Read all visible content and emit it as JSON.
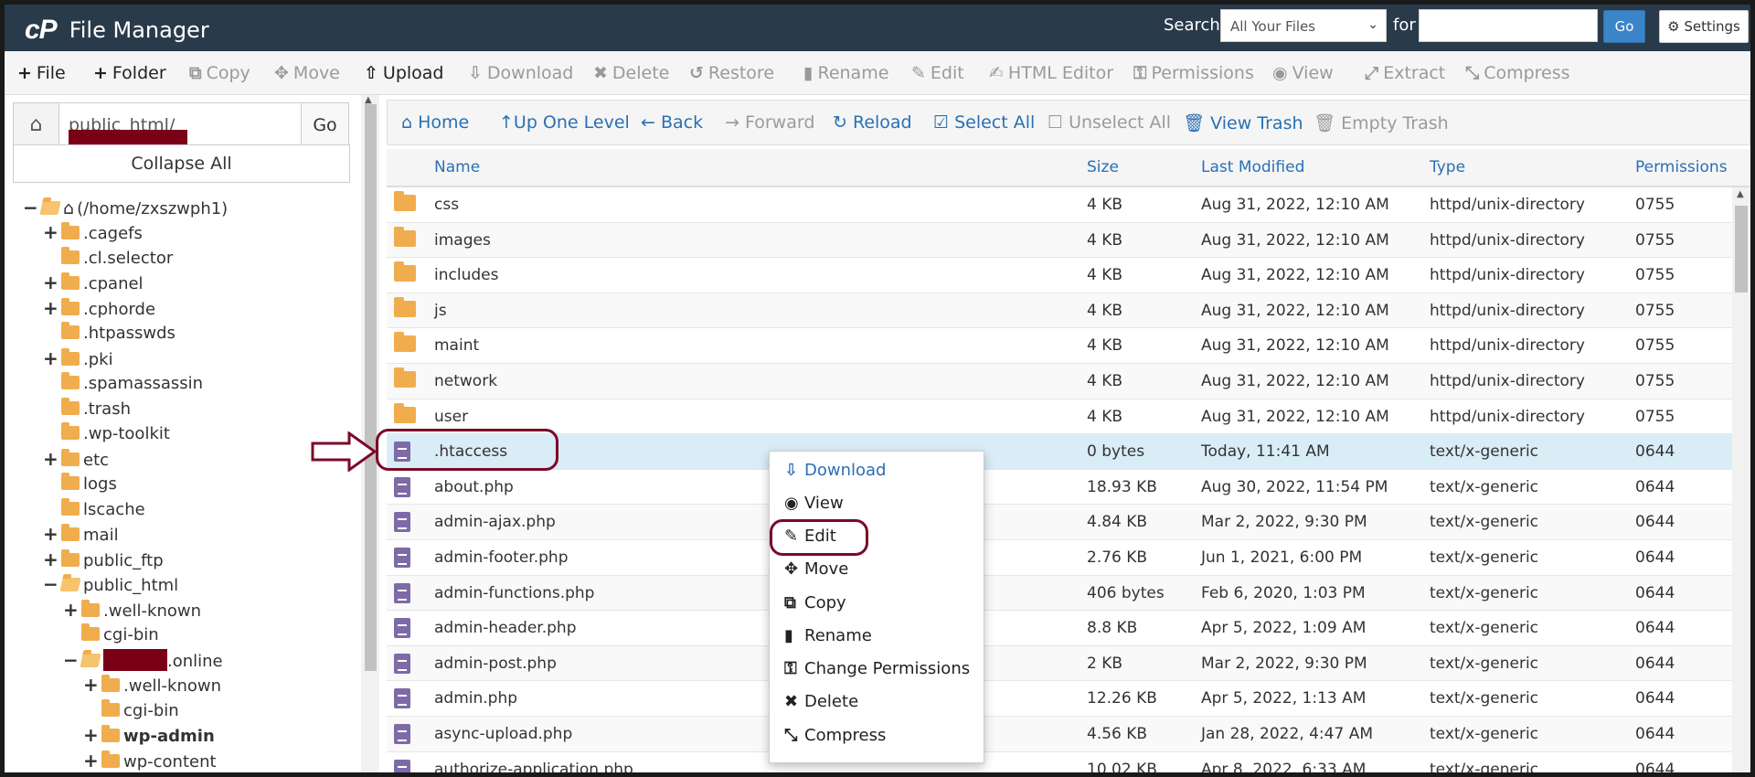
{
  "header": {
    "logo": "cP",
    "title": "File Manager",
    "search_label": "Search",
    "search_scope": "All Your Files",
    "for_label": "for",
    "search_value": "",
    "go_label": "Go",
    "settings_label": "Settings"
  },
  "toolbar": {
    "file": "File",
    "folder": "Folder",
    "copy": "Copy",
    "move": "Move",
    "upload": "Upload",
    "download": "Download",
    "delete": "Delete",
    "restore": "Restore",
    "rename": "Rename",
    "edit": "Edit",
    "html_editor": "HTML Editor",
    "permissions": "Permissions",
    "view": "View",
    "extract": "Extract",
    "compress": "Compress"
  },
  "sidebar": {
    "path_value": "public_html/",
    "go_label": "Go",
    "collapse_label": "Collapse All",
    "tree": [
      {
        "label": "(/home/zxszwph1)"
      },
      {
        "label": ".cagefs"
      },
      {
        "label": ".cl.selector"
      },
      {
        "label": ".cpanel"
      },
      {
        "label": ".cphorde"
      },
      {
        "label": ".htpasswds"
      },
      {
        "label": ".pki"
      },
      {
        "label": ".spamassassin"
      },
      {
        "label": ".trash"
      },
      {
        "label": ".wp-toolkit"
      },
      {
        "label": "etc"
      },
      {
        "label": "logs"
      },
      {
        "label": "lscache"
      },
      {
        "label": "mail"
      },
      {
        "label": "public_ftp"
      },
      {
        "label": "public_html"
      },
      {
        "label": ".well-known"
      },
      {
        "label": "cgi-bin"
      },
      {
        "label": ".online"
      },
      {
        "label": ".well-known"
      },
      {
        "label": "cgi-bin"
      },
      {
        "label": "wp-admin"
      },
      {
        "label": "wp-content"
      }
    ]
  },
  "nav": {
    "home": "Home",
    "up": "Up One Level",
    "back": "Back",
    "forward": "Forward",
    "reload": "Reload",
    "select_all": "Select All",
    "unselect_all": "Unselect All",
    "view_trash": "View Trash",
    "empty_trash": "Empty Trash"
  },
  "table": {
    "columns": [
      "Name",
      "Size",
      "Last Modified",
      "Type",
      "Permissions"
    ],
    "rows": [
      {
        "icon": "folder",
        "name": "css",
        "size": "4 KB",
        "modified": "Aug 31, 2022, 12:10 AM",
        "type": "httpd/unix-directory",
        "perm": "0755"
      },
      {
        "icon": "folder",
        "name": "images",
        "size": "4 KB",
        "modified": "Aug 31, 2022, 12:10 AM",
        "type": "httpd/unix-directory",
        "perm": "0755"
      },
      {
        "icon": "folder",
        "name": "includes",
        "size": "4 KB",
        "modified": "Aug 31, 2022, 12:10 AM",
        "type": "httpd/unix-directory",
        "perm": "0755"
      },
      {
        "icon": "folder",
        "name": "js",
        "size": "4 KB",
        "modified": "Aug 31, 2022, 12:10 AM",
        "type": "httpd/unix-directory",
        "perm": "0755"
      },
      {
        "icon": "folder",
        "name": "maint",
        "size": "4 KB",
        "modified": "Aug 31, 2022, 12:10 AM",
        "type": "httpd/unix-directory",
        "perm": "0755"
      },
      {
        "icon": "folder",
        "name": "network",
        "size": "4 KB",
        "modified": "Aug 31, 2022, 12:10 AM",
        "type": "httpd/unix-directory",
        "perm": "0755"
      },
      {
        "icon": "folder",
        "name": "user",
        "size": "4 KB",
        "modified": "Aug 31, 2022, 12:10 AM",
        "type": "httpd/unix-directory",
        "perm": "0755"
      },
      {
        "icon": "file",
        "name": ".htaccess",
        "size": "0 bytes",
        "modified": "Today, 11:41 AM",
        "type": "text/x-generic",
        "perm": "0644",
        "selected": true
      },
      {
        "icon": "file",
        "name": "about.php",
        "size": "18.93 KB",
        "modified": "Aug 30, 2022, 11:54 PM",
        "type": "text/x-generic",
        "perm": "0644"
      },
      {
        "icon": "file",
        "name": "admin-ajax.php",
        "size": "4.84 KB",
        "modified": "Mar 2, 2022, 9:30 PM",
        "type": "text/x-generic",
        "perm": "0644"
      },
      {
        "icon": "file",
        "name": "admin-footer.php",
        "size": "2.76 KB",
        "modified": "Jun 1, 2021, 6:00 PM",
        "type": "text/x-generic",
        "perm": "0644"
      },
      {
        "icon": "file",
        "name": "admin-functions.php",
        "size": "406 bytes",
        "modified": "Feb 6, 2020, 1:03 PM",
        "type": "text/x-generic",
        "perm": "0644"
      },
      {
        "icon": "file",
        "name": "admin-header.php",
        "size": "8.8 KB",
        "modified": "Apr 5, 2022, 1:09 AM",
        "type": "text/x-generic",
        "perm": "0644"
      },
      {
        "icon": "file",
        "name": "admin-post.php",
        "size": "2 KB",
        "modified": "Mar 2, 2022, 9:30 PM",
        "type": "text/x-generic",
        "perm": "0644"
      },
      {
        "icon": "file",
        "name": "admin.php",
        "size": "12.26 KB",
        "modified": "Apr 5, 2022, 1:13 AM",
        "type": "text/x-generic",
        "perm": "0644"
      },
      {
        "icon": "file",
        "name": "async-upload.php",
        "size": "4.56 KB",
        "modified": "Jan 28, 2022, 4:47 AM",
        "type": "text/x-generic",
        "perm": "0644"
      },
      {
        "icon": "file",
        "name": "authorize-application.php",
        "size": "10.02 KB",
        "modified": "Apr 8, 2022, 6:33 AM",
        "type": "text/x-generic",
        "perm": "0644"
      }
    ]
  },
  "context_menu": {
    "items": [
      {
        "label": "Download",
        "icon": "download-icon"
      },
      {
        "label": "View",
        "icon": "eye-icon"
      },
      {
        "label": "Edit",
        "icon": "pencil-icon"
      },
      {
        "label": "Move",
        "icon": "move-icon"
      },
      {
        "label": "Copy",
        "icon": "copy-icon"
      },
      {
        "label": "Rename",
        "icon": "file-icon"
      },
      {
        "label": "Change Permissions",
        "icon": "key-icon"
      },
      {
        "label": "Delete",
        "icon": "delete-icon"
      },
      {
        "label": "Compress",
        "icon": "compress-icon"
      }
    ]
  },
  "colors": {
    "header_bg": "#293a4a",
    "link": "#2a6fb5",
    "folder": "#f0ad4e",
    "file": "#7e6aa6",
    "highlight": "#7a0a28",
    "selected_row": "#d9edf7"
  }
}
